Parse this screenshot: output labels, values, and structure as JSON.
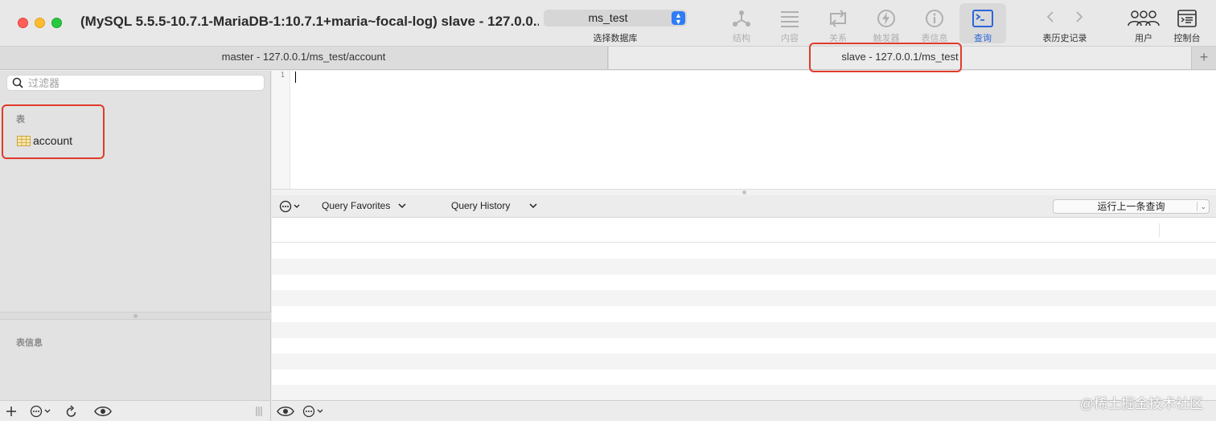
{
  "window": {
    "title": "(MySQL 5.5.5-10.7.1-MariaDB-1:10.7.1+maria~focal-log) slave - 127.0.0...."
  },
  "database_selector": {
    "value": "ms_test",
    "caption": "选择数据库"
  },
  "toolbar": {
    "structure": "结构",
    "content": "内容",
    "relations": "关系",
    "triggers": "触发器",
    "table_info": "表信息",
    "query": "查询",
    "history": "表历史记录",
    "users": "用户",
    "console": "控制台"
  },
  "tabs": [
    {
      "label": "master - 127.0.0.1/ms_test/account"
    },
    {
      "label": "slave - 127.0.0.1/ms_test"
    }
  ],
  "tab_add": "+",
  "sidebar": {
    "filter_placeholder": "过滤器",
    "tables_header": "表",
    "tables": [
      {
        "name": "account"
      }
    ],
    "info_header": "表信息"
  },
  "editor": {
    "line_numbers": [
      "1"
    ],
    "content": ""
  },
  "query_bar": {
    "favorites": "Query Favorites",
    "history": "Query History",
    "run_last": "运行上一条查询"
  },
  "watermark": "@稀土掘金技术社区",
  "colors": {
    "accent": "#2f7cf6",
    "highlight": "#e03b2a",
    "traffic_red": "#fe5f57",
    "traffic_yellow": "#febc2e",
    "traffic_green": "#28c840"
  }
}
